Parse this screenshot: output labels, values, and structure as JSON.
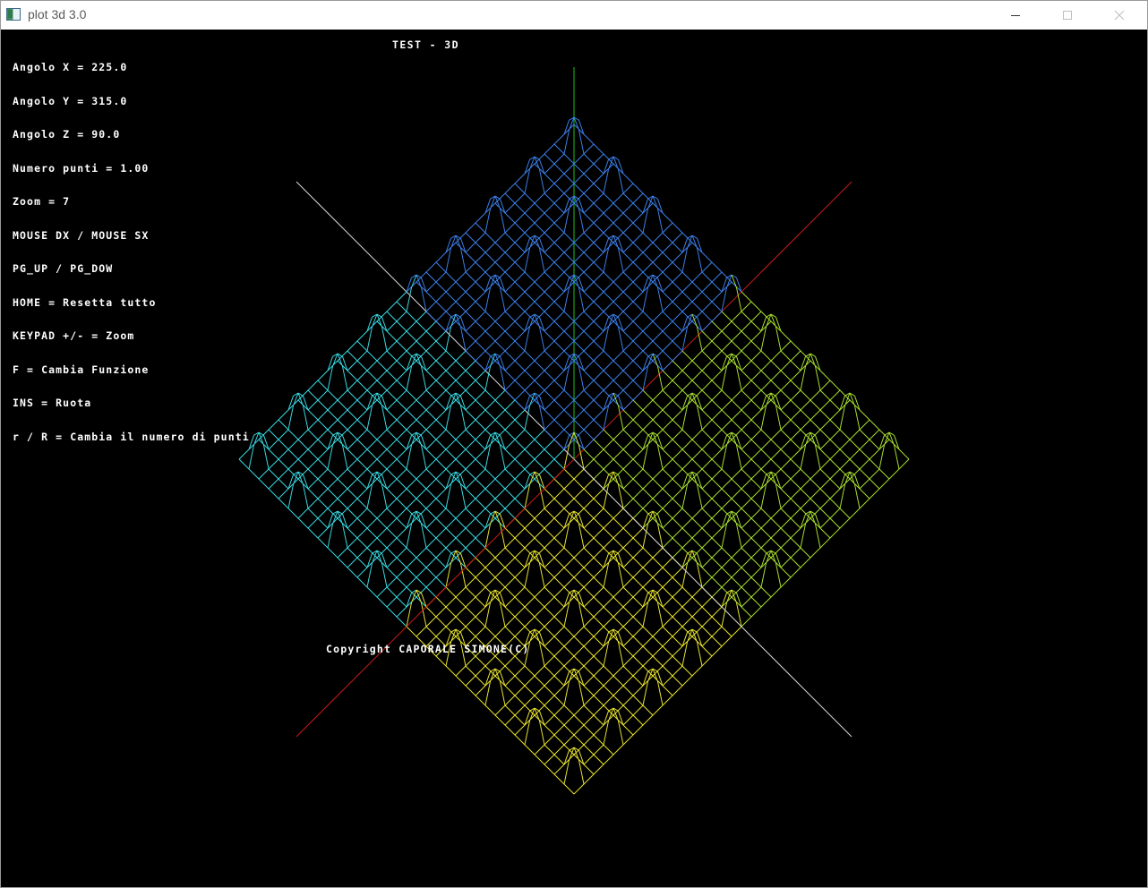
{
  "window": {
    "title": "plot 3d 3.0",
    "minimize_icon": "minimize-icon",
    "maximize_icon": "maximize-icon",
    "close_icon": "close-icon"
  },
  "info_lines": [
    "Angolo X = 225.0",
    "Angolo Y = 315.0",
    "Angolo Z = 90.0",
    "Numero punti = 1.00",
    "Zoom = 7",
    "MOUSE DX / MOUSE SX",
    "PG_UP / PG_DOW",
    "HOME = Resetta tutto",
    "KEYPAD +/- = Zoom",
    "F = Cambia Funzione",
    "INS = Ruota",
    "r / R = Cambia il numero di punti"
  ],
  "plot_title": "TEST - 3D",
  "copyright": "Copyright CAPORALE SIMONE(C)",
  "colors": {
    "background": "#000000",
    "text": "#ffffff",
    "axis_vertical": "#20c020",
    "axis_red": "#c81818",
    "axis_white": "#d8d8d8",
    "surface_top": "#3c7ee6",
    "surface_left": "#38d8e0",
    "surface_right": "#a6dc2e",
    "surface_bottom": "#e6e22e"
  }
}
